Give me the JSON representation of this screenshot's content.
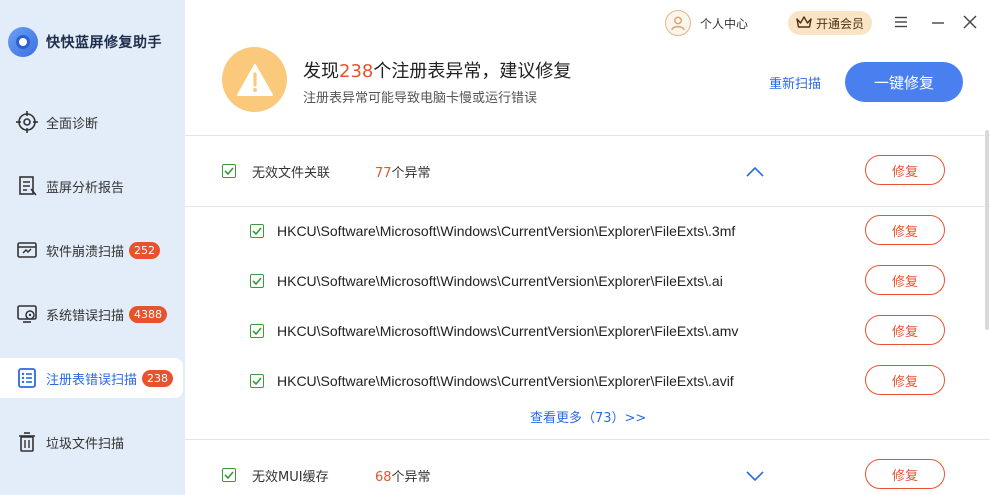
{
  "app": {
    "title": "快快蓝屏修复助手"
  },
  "sidebar": {
    "items": [
      {
        "label": "全面诊断",
        "badge": "",
        "icon": "target-icon"
      },
      {
        "label": "蓝屏分析报告",
        "badge": "",
        "icon": "report-icon"
      },
      {
        "label": "软件崩溃扫描",
        "badge": "252",
        "icon": "app-crash-icon"
      },
      {
        "label": "系统错误扫描",
        "badge": "4388",
        "icon": "system-error-icon"
      },
      {
        "label": "注册表错误扫描",
        "badge": "238",
        "icon": "registry-icon",
        "active": true
      },
      {
        "label": "垃圾文件扫描",
        "badge": "",
        "icon": "trash-icon"
      }
    ]
  },
  "topbar": {
    "user_center": "个人中心",
    "vip": "开通会员"
  },
  "summary": {
    "title_prefix": "发现",
    "count": "238",
    "title_suffix": "个注册表异常，建议修复",
    "subtitle": "注册表异常可能导致电脑卡慢或运行错误",
    "rescan": "重新扫描",
    "fix_all": "一键修复"
  },
  "groups": [
    {
      "name": "无效文件关联",
      "count": "77",
      "count_suffix": "个异常",
      "fix": "修复",
      "expanded": true,
      "entries": [
        {
          "path": "HKCU\\Software\\Microsoft\\Windows\\CurrentVersion\\Explorer\\FileExts\\.3mf",
          "fix": "修复"
        },
        {
          "path": "HKCU\\Software\\Microsoft\\Windows\\CurrentVersion\\Explorer\\FileExts\\.ai",
          "fix": "修复"
        },
        {
          "path": "HKCU\\Software\\Microsoft\\Windows\\CurrentVersion\\Explorer\\FileExts\\.amv",
          "fix": "修复"
        },
        {
          "path": "HKCU\\Software\\Microsoft\\Windows\\CurrentVersion\\Explorer\\FileExts\\.avif",
          "fix": "修复"
        }
      ],
      "see_more": "查看更多（73）>>"
    },
    {
      "name": "无效MUI缓存",
      "count": "68",
      "count_suffix": "个异常",
      "fix": "修复",
      "expanded": false
    }
  ],
  "colors": {
    "accent": "#4a7ff0",
    "warning": "#e8532f",
    "sidebar_bg": "#e3edf9",
    "warn_circle": "#fac97c"
  }
}
